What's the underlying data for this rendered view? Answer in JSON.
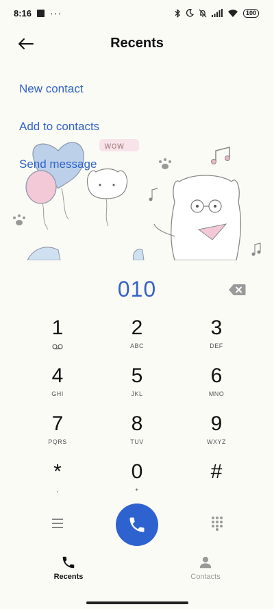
{
  "status_bar": {
    "time": "8:16",
    "overflow": "···",
    "battery": "100",
    "icons": [
      "bluetooth-icon",
      "moon-icon",
      "bell-off-icon",
      "signal-icon",
      "wifi-icon"
    ]
  },
  "header": {
    "title": "Recents"
  },
  "actions": [
    {
      "label": "New contact"
    },
    {
      "label": "Add to contacts"
    },
    {
      "label": "Send message"
    }
  ],
  "illustration": {
    "text": "wow"
  },
  "dialer": {
    "number": "010"
  },
  "keypad": [
    [
      {
        "digit": "1",
        "sub": ""
      },
      {
        "digit": "2",
        "sub": "ABC"
      },
      {
        "digit": "3",
        "sub": "DEF"
      }
    ],
    [
      {
        "digit": "4",
        "sub": "GHI"
      },
      {
        "digit": "5",
        "sub": "JKL"
      },
      {
        "digit": "6",
        "sub": "MNO"
      }
    ],
    [
      {
        "digit": "7",
        "sub": "PQRS"
      },
      {
        "digit": "8",
        "sub": "TUV"
      },
      {
        "digit": "9",
        "sub": "WXYZ"
      }
    ],
    [
      {
        "digit": "*",
        "sub": ","
      },
      {
        "digit": "0",
        "sub": "+"
      },
      {
        "digit": "#",
        "sub": ""
      }
    ]
  ],
  "bottom_nav": {
    "tabs": [
      {
        "label": "Recents",
        "icon": "phone-icon",
        "active": true
      },
      {
        "label": "Contacts",
        "icon": "person-icon",
        "active": false
      }
    ]
  },
  "colors": {
    "accent": "#2f62c9",
    "call": "#2e62cf",
    "background": "#fbfbf6"
  }
}
